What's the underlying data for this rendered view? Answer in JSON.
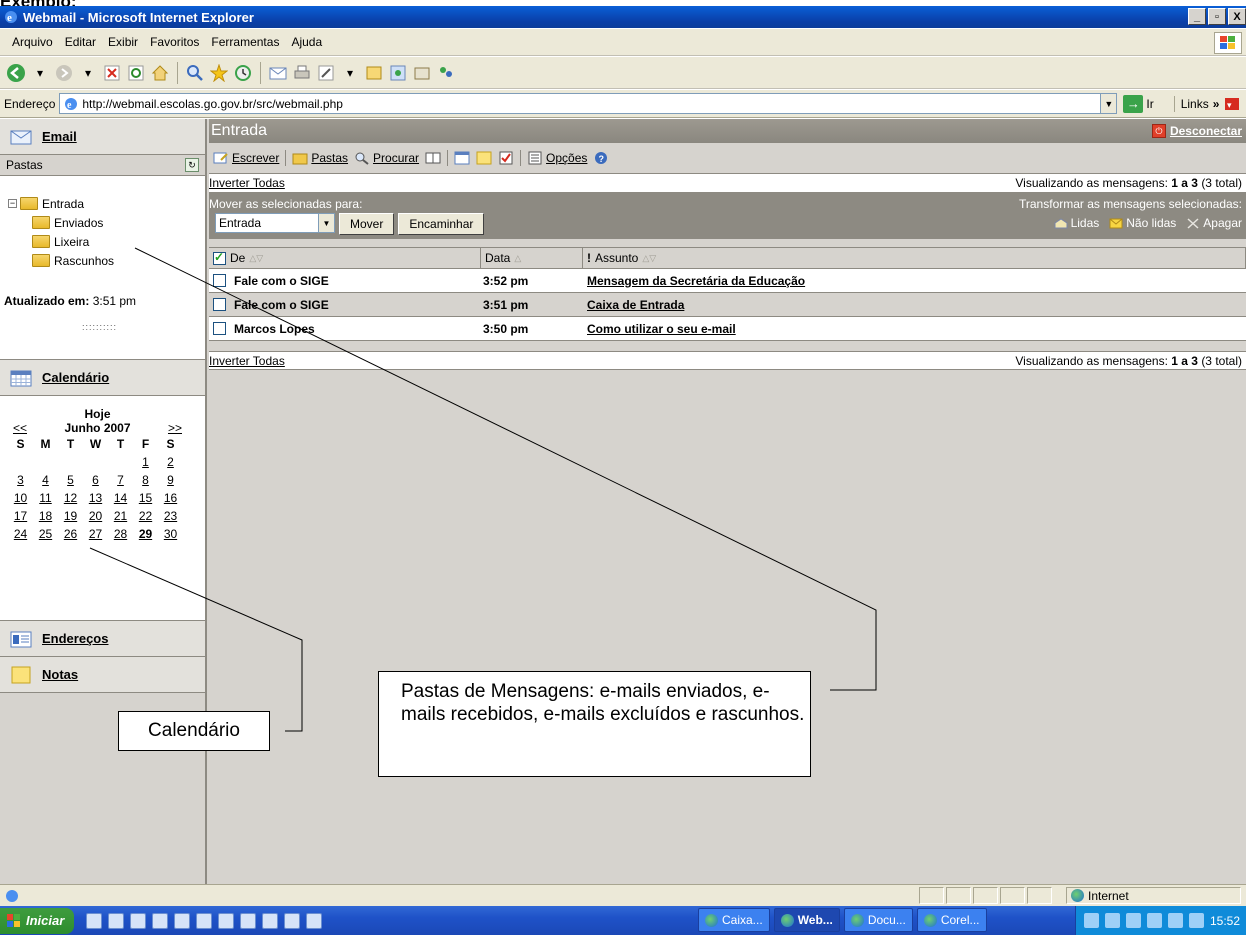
{
  "doc_heading": "Exemplo:",
  "window": {
    "title": "Webmail - Microsoft Internet Explorer",
    "buttons": [
      "_",
      "̵",
      "X"
    ]
  },
  "menubar": {
    "items": [
      "Arquivo",
      "Editar",
      "Exibir",
      "Favoritos",
      "Ferramentas",
      "Ajuda"
    ]
  },
  "address": {
    "label": "Endereço",
    "url": "http://webmail.escolas.go.gov.br/src/webmail.php",
    "go_label": "Ir",
    "links_label": "Links",
    "chevron": "»"
  },
  "sidebar": {
    "email_label": "Email",
    "pastas_label": "Pastas",
    "folders": [
      {
        "name": "Entrada",
        "expander": "⊟"
      },
      {
        "name": "Enviados"
      },
      {
        "name": "Lixeira"
      },
      {
        "name": "Rascunhos"
      }
    ],
    "atualizado_label": "Atualizado em:",
    "atualizado_time": "3:51 pm",
    "grip": "::::::::::",
    "calendario_label": "Calendário",
    "enderecos_label": "Endereços",
    "notas_label": "Notas"
  },
  "calendar": {
    "today_label": "Hoje",
    "prev": "<<",
    "next": ">>",
    "month": "Junho 2007",
    "day_names": [
      "S",
      "M",
      "T",
      "W",
      "T",
      "F",
      "S"
    ],
    "weeks": [
      [
        "",
        "",
        "",
        "",
        "",
        "1",
        "2"
      ],
      [
        "3",
        "4",
        "5",
        "6",
        "7",
        "8",
        "9"
      ],
      [
        "10",
        "11",
        "12",
        "13",
        "14",
        "15",
        "16"
      ],
      [
        "17",
        "18",
        "19",
        "20",
        "21",
        "22",
        "23"
      ],
      [
        "24",
        "25",
        "26",
        "27",
        "28",
        "29",
        "30"
      ]
    ],
    "today": "29"
  },
  "main": {
    "title": "Entrada",
    "disconnect_label": "Desconectar",
    "toolbar": {
      "escrever": "Escrever",
      "pastas": "Pastas",
      "procurar": "Procurar",
      "opcoes": "Opções"
    },
    "invert_all": "Inverter Todas",
    "viewing_prefix": "Visualizando as mensagens:",
    "viewing_range": "1 a 3",
    "viewing_total": "(3 total)",
    "move_label": "Mover as selecionadas para:",
    "move_select_value": "Entrada",
    "move_button": "Mover",
    "forward_button": "Encaminhar",
    "transform_label": "Transformar as mensagens selecionadas:",
    "read_label": "Lidas",
    "unread_label": "Não lidas",
    "delete_label": "Apagar",
    "columns": {
      "from": "De",
      "date": "Data",
      "subject": "Assunto",
      "sort_both": "△▽",
      "sort_up": "△",
      "flag": "!"
    },
    "messages": [
      {
        "from": "Fale com o SIGE",
        "date": "3:52 pm",
        "subject": "Mensagem da Secretária da Educação"
      },
      {
        "from": "Fale com o SIGE",
        "date": "3:51 pm",
        "subject": "Caixa de Entrada"
      },
      {
        "from": "Marcos Lopes",
        "date": "3:50 pm",
        "subject": "Como utilizar o seu e-mail"
      }
    ]
  },
  "callouts": {
    "calendario": "Calendário",
    "pastas": "Pastas de Mensagens: e-mails enviados, e-mails recebidos, e-mails excluídos e rascunhos."
  },
  "statusbar": {
    "zone": "Internet"
  },
  "taskbar": {
    "start_label": "Iniciar",
    "tasks": [
      "Caixa...",
      "Web...",
      "Docu...",
      "Corel..."
    ],
    "clock": "15:52"
  }
}
